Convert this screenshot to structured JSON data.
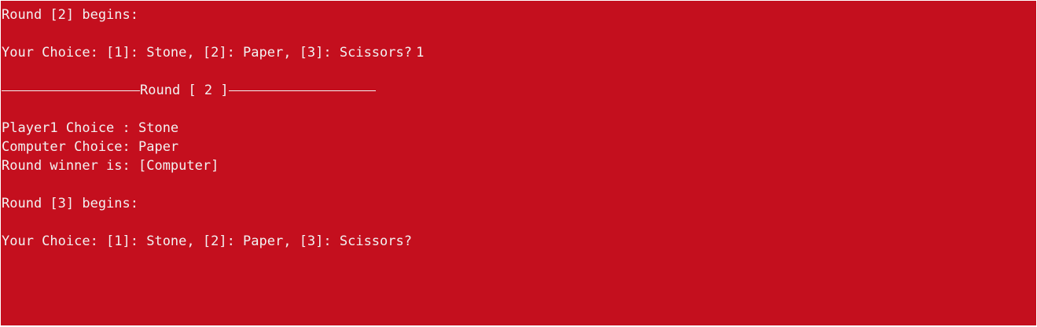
{
  "console": {
    "round2_begins": "Round [2] begins:",
    "choice_prompt_1": "Your Choice: [1]: Stone, [2]: Paper, [3]: Scissors?",
    "choice_input_1": "1",
    "round_header": "Round [ 2 ]",
    "player1_choice": "Player1 Choice : Stone",
    "computer_choice": "Computer Choice: Paper",
    "round_winner": "Round winner is: [Computer]",
    "round3_begins": "Round [3] begins:",
    "choice_prompt_2": "Your Choice: [1]: Stone, [2]: Paper, [3]: Scissors?"
  }
}
